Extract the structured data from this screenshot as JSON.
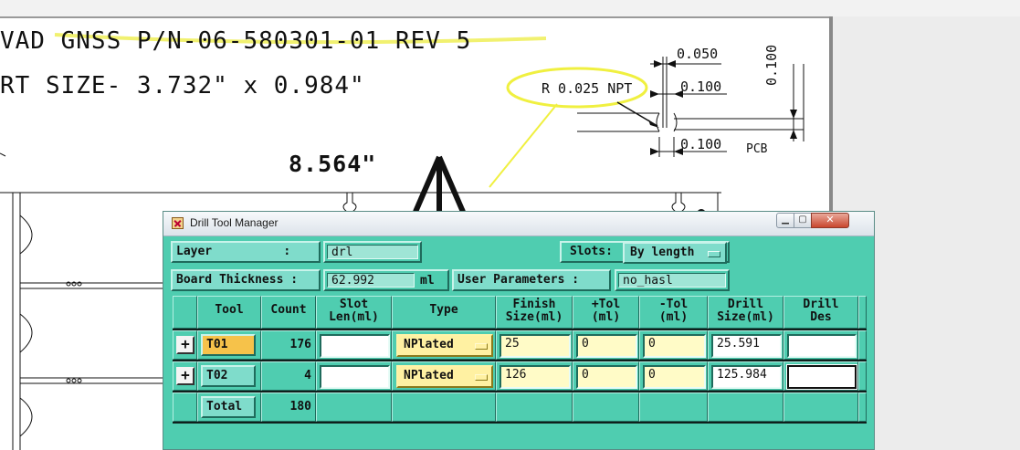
{
  "cad": {
    "title_line": "VAD GNSS P/N-06-580301-01 REV 5",
    "size_line": "RT SIZE- 3.732\" x 0.984\"",
    "width_dim": "8.564\"",
    "callout": "R 0.025 NPT",
    "dim_050": "0.050",
    "dim_100_a": "0.100",
    "dim_100_b": "0.100",
    "dim_100_vert": "0.100",
    "pcb_label": "PCB"
  },
  "dialog": {
    "title": "Drill Tool Manager",
    "controls": {
      "minimize": "▁",
      "maximize": "▢",
      "close": "✕"
    },
    "layer": {
      "label": "Layer          :",
      "value": "drl"
    },
    "slots": {
      "label": "Slots:",
      "value": "By length"
    },
    "board_thickness": {
      "label": "Board Thickness :",
      "value": "62.992",
      "unit": "ml"
    },
    "user_parameters": {
      "label": "User Parameters :",
      "value": "no_hasl"
    },
    "columns": [
      "Tool",
      "Count",
      "Slot\nLen(ml)",
      "Type",
      "Finish\nSize(ml)",
      "+Tol\n(ml)",
      "-Tol\n(ml)",
      "Drill\nSize(ml)",
      "Drill\nDes"
    ],
    "rows": [
      {
        "tool": "T01",
        "count": "176",
        "slot_len": "",
        "type": "NPlated",
        "finish": "25",
        "plus_tol": "0",
        "minus_tol": "0",
        "drill_size": "25.591",
        "drill_des": ""
      },
      {
        "tool": "T02",
        "count": "4",
        "slot_len": "",
        "type": "NPlated",
        "finish": "126",
        "plus_tol": "0",
        "minus_tol": "0",
        "drill_size": "125.984",
        "drill_des": ""
      }
    ],
    "total": {
      "label": "Total",
      "count": "180"
    }
  }
}
